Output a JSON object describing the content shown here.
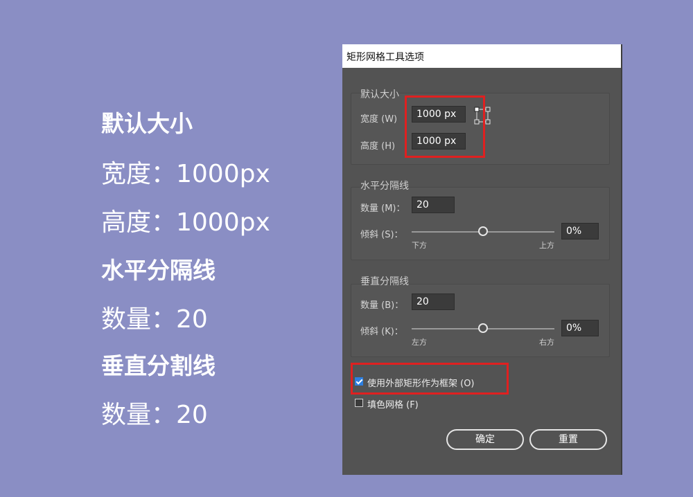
{
  "left_panel": {
    "default_size_heading": "默认大小",
    "width_line": "宽度：1000px",
    "height_line": "高度：1000px",
    "horizontal_heading": "水平分隔线",
    "horizontal_count_line": "数量：20",
    "vertical_heading": "垂直分割线",
    "vertical_count_line": "数量：20"
  },
  "dialog": {
    "title": "矩形网格工具选项",
    "default_size": {
      "group_title": "默认大小",
      "width_label": "宽度 (W)",
      "width_value": "1000 px",
      "height_label": "高度 (H)",
      "height_value": "1000 px",
      "anchor_icon": "reference-point-icon"
    },
    "horizontal": {
      "group_title": "水平分隔线",
      "count_label": "数量 (M)：",
      "count_value": "20",
      "skew_label": "倾斜 (S)：",
      "skew_value": "0%",
      "skew_slider_fraction": 0.5,
      "tick_left": "下方",
      "tick_right": "上方"
    },
    "vertical": {
      "group_title": "垂直分隔线",
      "count_label": "数量 (B)：",
      "count_value": "20",
      "skew_label": "倾斜 (K)：",
      "skew_value": "0%",
      "skew_slider_fraction": 0.5,
      "tick_left": "左方",
      "tick_right": "右方"
    },
    "use_outer_rect_label": "使用外部矩形作为框架 (O)",
    "use_outer_rect_checked": true,
    "fill_grid_label": "填色网格 (F)",
    "fill_grid_checked": false,
    "ok_label": "确定",
    "reset_label": "重置"
  },
  "colors": {
    "background": "#8a8ec4",
    "dialog": "#535353",
    "highlight": "#e02020",
    "checkbox_accent": "#2d7fe0"
  }
}
